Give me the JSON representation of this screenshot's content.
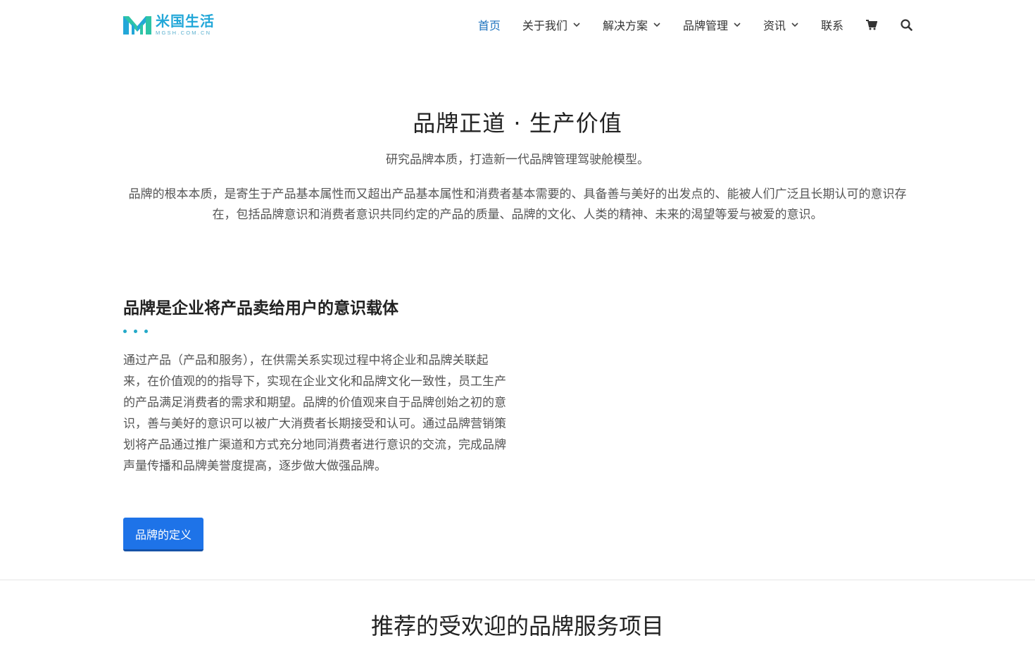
{
  "header": {
    "logo": {
      "name_cn": "米国生活",
      "name_en": "MGSH.COM.CN",
      "colors": [
        "#22a7d8",
        "#2ec4a6"
      ]
    },
    "nav": [
      {
        "label": "首页",
        "active": true,
        "dropdown": false
      },
      {
        "label": "关于我们",
        "active": false,
        "dropdown": true
      },
      {
        "label": "解决方案",
        "active": false,
        "dropdown": true
      },
      {
        "label": "品牌管理",
        "active": false,
        "dropdown": true
      },
      {
        "label": "资讯",
        "active": false,
        "dropdown": true
      },
      {
        "label": "联系",
        "active": false,
        "dropdown": false
      }
    ],
    "icons": [
      "cart-icon",
      "search-icon"
    ],
    "active_color": "#1e73be"
  },
  "hero": {
    "title": "品牌正道 · 生产价值",
    "subtitle": "研究品牌本质，打造新一代品牌管理驾驶舱模型。",
    "description": "品牌的根本本质，是寄生于产品基本属性而又超出产品基本属性和消费者基本需要的、具备善与美好的出发点的、能被人们广泛且长期认可的意识存在，包括品牌意识和消费者意识共同约定的产品的质量、品牌的文化、人类的精神、未来的渴望等爱与被爱的意识。"
  },
  "feature": {
    "title": "品牌是企业将产品卖给用户的意识载体",
    "body": "通过产品（产品和服务），在供需关系实现过程中将企业和品牌关联起来，在价值观的的指导下，实现在企业文化和品牌文化一致性，员工生产的产品满足消费者的需求和期望。品牌的价值观来自于品牌创始之初的意识，善与美好的意识可以被广大消费者长期接受和认可。通过品牌营销策划将产品通过推广渠道和方式充分地同消费者进行意识的交流，完成品牌声量传播和品牌美誉度提高，逐步做大做强品牌。",
    "button_label": "品牌的定义",
    "accent_color": "#23a9c8",
    "button_color": "#1e73e8"
  },
  "services": {
    "title": "推荐的受欢迎的品牌服务项目"
  }
}
